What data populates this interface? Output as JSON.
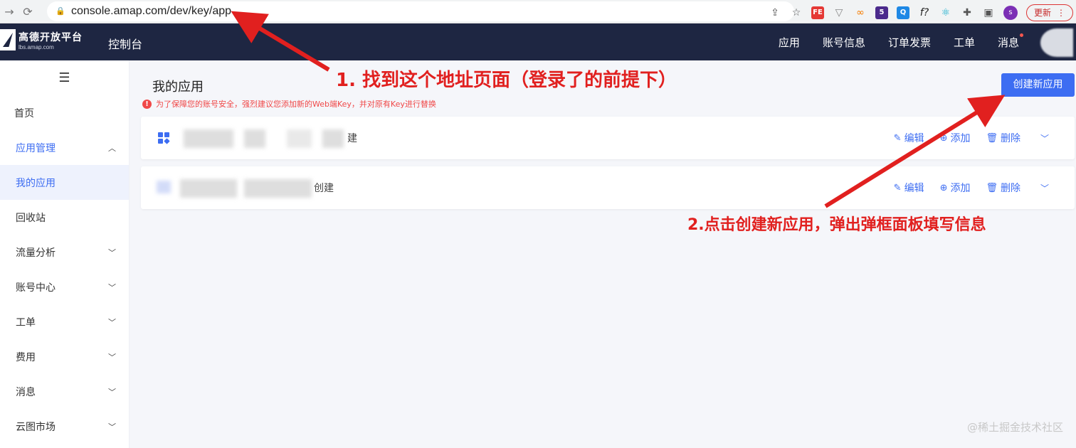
{
  "browser": {
    "url": "console.amap.com/dev/key/app",
    "profile_initial": "s",
    "update_label": "更新",
    "ext_badge": "5",
    "ext_fe": "FE",
    "ext_f": "f?"
  },
  "header": {
    "logo_text": "高德开放平台",
    "logo_subtext": "lbs.amap.com",
    "console_label": "控制台",
    "nav": [
      "应用",
      "账号信息",
      "订单发票",
      "工单",
      "消息"
    ]
  },
  "sidebar": {
    "items": [
      {
        "label": "首页"
      },
      {
        "label": "应用管理"
      },
      {
        "label": "我的应用"
      },
      {
        "label": "回收站"
      },
      {
        "label": "流量分析"
      },
      {
        "label": "账号中心"
      },
      {
        "label": "工单"
      },
      {
        "label": "费用"
      },
      {
        "label": "消息"
      },
      {
        "label": "云图市场"
      }
    ]
  },
  "main": {
    "title": "我的应用",
    "warning": "为了保障您的账号安全，强烈建议您添加新的Web端Key，并对原有Key进行替换",
    "create_button": "创建新应用",
    "apps": [
      {
        "name_suffix": "建"
      },
      {
        "name_suffix": "创建"
      }
    ],
    "actions": {
      "edit": "编辑",
      "add": "添加",
      "delete": "删除"
    }
  },
  "annotations": {
    "step1": "1. 找到这个地址页面（登录了的前提下）",
    "step2": "2.点击创建新应用，弹出弹框面板填写信息"
  },
  "watermark": "@稀土掘金技术社区",
  "colors": {
    "primary": "#3d6df2",
    "header_bg": "#1e2642",
    "warning": "#f04848",
    "annotation": "#e1201f"
  }
}
